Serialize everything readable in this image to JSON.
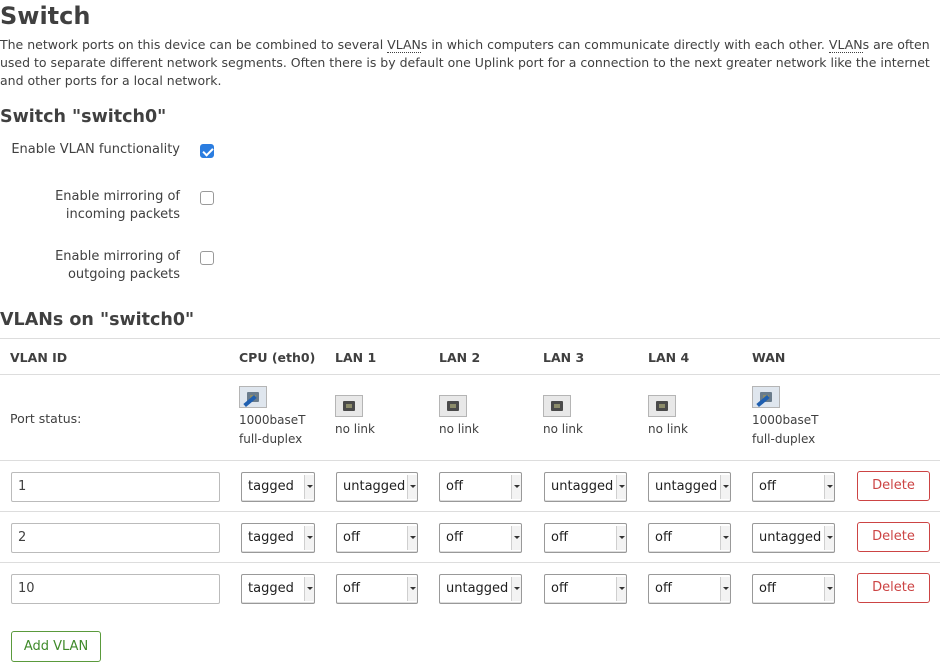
{
  "page": {
    "title": "Switch",
    "description_parts": [
      "The network ports on this device can be combined to several ",
      "VLAN",
      "s in which computers can communicate directly with each other. ",
      "VLAN",
      "s are often used to separate different network segments. Often there is by default one Uplink port for a connection to the next greater network like the internet and other ports for a local network."
    ]
  },
  "switch_section": {
    "heading": "Switch \"switch0\"",
    "options": [
      {
        "label": "Enable VLAN functionality",
        "checked": true
      },
      {
        "label": "Enable mirroring of incoming packets",
        "checked": false
      },
      {
        "label": "Enable mirroring of outgoing packets",
        "checked": false
      }
    ]
  },
  "vlan_section": {
    "heading": "VLANs on \"switch0\"",
    "columns": [
      "VLAN ID",
      "CPU (eth0)",
      "LAN 1",
      "LAN 2",
      "LAN 3",
      "LAN 4",
      "WAN"
    ],
    "port_status_label": "Port status:",
    "ports": [
      {
        "line1": "1000baseT",
        "line2": "full-duplex",
        "link": true
      },
      {
        "line1": "no link",
        "line2": "",
        "link": false
      },
      {
        "line1": "no link",
        "line2": "",
        "link": false
      },
      {
        "line1": "no link",
        "line2": "",
        "link": false
      },
      {
        "line1": "no link",
        "line2": "",
        "link": false
      },
      {
        "line1": "1000baseT",
        "line2": "full-duplex",
        "link": true
      }
    ],
    "rows": [
      {
        "vlan_id": "1",
        "cells": [
          "tagged",
          "untagged",
          "off",
          "untagged",
          "untagged",
          "off"
        ],
        "delete_label": "Delete"
      },
      {
        "vlan_id": "2",
        "cells": [
          "tagged",
          "off",
          "off",
          "off",
          "off",
          "untagged"
        ],
        "delete_label": "Delete"
      },
      {
        "vlan_id": "10",
        "cells": [
          "tagged",
          "off",
          "untagged",
          "off",
          "off",
          "off"
        ],
        "delete_label": "Delete"
      }
    ],
    "add_label": "Add VLAN"
  },
  "icons": {
    "port_up": "ethernet-port-connected-icon",
    "port_down": "ethernet-port-disconnected-icon",
    "dropdown": "chevron-down-icon"
  },
  "colors": {
    "checkbox_checked": "#2b7de0",
    "delete_button": "#cc4444",
    "add_button": "#3f8a2a"
  }
}
